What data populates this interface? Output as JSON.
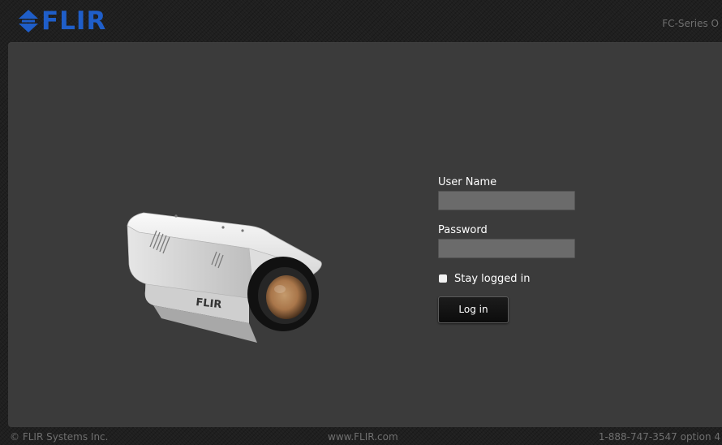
{
  "header": {
    "logo_text": "FLIR",
    "product_name": "FC-Series O"
  },
  "camera_image": {
    "housing_brand": "FLIR"
  },
  "login": {
    "username_label": "User Name",
    "username_value": "",
    "password_label": "Password",
    "password_value": "",
    "remember_label": "Stay logged in",
    "remember_checked": false,
    "login_button": "Log in"
  },
  "footer": {
    "copyright": "© FLIR Systems Inc.",
    "website": "www.FLIR.com",
    "phone": "1-888-747-3547 option 4"
  },
  "colors": {
    "brand": "#1f5ec9",
    "panel": "#3b3b3b",
    "background": "#1f1f1f"
  }
}
